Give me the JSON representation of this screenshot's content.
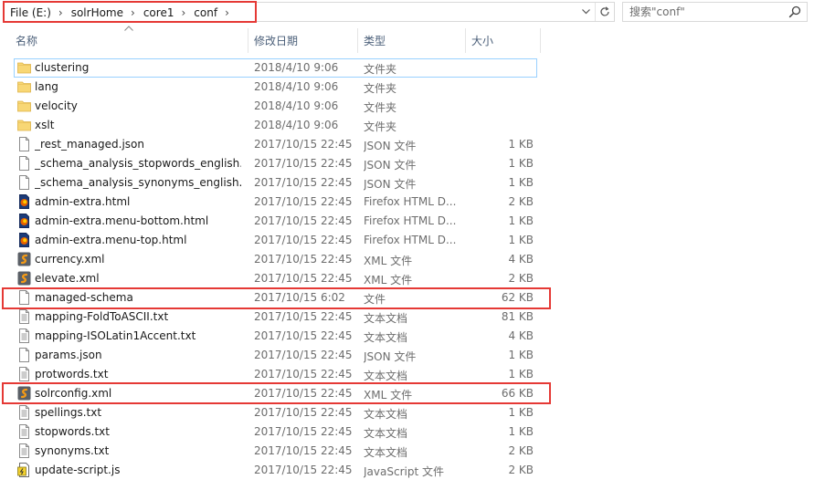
{
  "breadcrumb": [
    "File (E:)",
    "solrHome",
    "core1",
    "conf"
  ],
  "search": {
    "placeholder": "搜索\"conf\""
  },
  "columns": {
    "name": "名称",
    "modified": "修改日期",
    "type": "类型",
    "size": "大小"
  },
  "colors": {
    "highlight": "#e53935",
    "focus": "#99d1ff",
    "folder": "#f8d775",
    "xml": "#f59b16",
    "firefox": "#e66000"
  },
  "files": [
    {
      "name": "clustering",
      "modified": "2018/4/10 9:06",
      "type": "文件夹",
      "size": "",
      "icon": "folder-icon"
    },
    {
      "name": "lang",
      "modified": "2018/4/10 9:06",
      "type": "文件夹",
      "size": "",
      "icon": "folder-icon"
    },
    {
      "name": "velocity",
      "modified": "2018/4/10 9:06",
      "type": "文件夹",
      "size": "",
      "icon": "folder-icon"
    },
    {
      "name": "xslt",
      "modified": "2018/4/10 9:06",
      "type": "文件夹",
      "size": "",
      "icon": "folder-icon"
    },
    {
      "name": "_rest_managed.json",
      "modified": "2017/10/15 22:45",
      "type": "JSON 文件",
      "size": "1 KB",
      "icon": "file-icon"
    },
    {
      "name": "_schema_analysis_stopwords_english....",
      "modified": "2017/10/15 22:45",
      "type": "JSON 文件",
      "size": "1 KB",
      "icon": "file-icon"
    },
    {
      "name": "_schema_analysis_synonyms_english.j...",
      "modified": "2017/10/15 22:45",
      "type": "JSON 文件",
      "size": "1 KB",
      "icon": "file-icon"
    },
    {
      "name": "admin-extra.html",
      "modified": "2017/10/15 22:45",
      "type": "Firefox HTML D...",
      "size": "2 KB",
      "icon": "firefox-html-icon"
    },
    {
      "name": "admin-extra.menu-bottom.html",
      "modified": "2017/10/15 22:45",
      "type": "Firefox HTML D...",
      "size": "1 KB",
      "icon": "firefox-html-icon"
    },
    {
      "name": "admin-extra.menu-top.html",
      "modified": "2017/10/15 22:45",
      "type": "Firefox HTML D...",
      "size": "1 KB",
      "icon": "firefox-html-icon"
    },
    {
      "name": "currency.xml",
      "modified": "2017/10/15 22:45",
      "type": "XML 文件",
      "size": "4 KB",
      "icon": "xml-file-icon"
    },
    {
      "name": "elevate.xml",
      "modified": "2017/10/15 22:45",
      "type": "XML 文件",
      "size": "2 KB",
      "icon": "xml-file-icon"
    },
    {
      "name": "managed-schema",
      "modified": "2017/10/15 6:02",
      "type": "文件",
      "size": "62 KB",
      "icon": "file-icon"
    },
    {
      "name": "mapping-FoldToASCII.txt",
      "modified": "2017/10/15 22:45",
      "type": "文本文档",
      "size": "81 KB",
      "icon": "text-file-icon"
    },
    {
      "name": "mapping-ISOLatin1Accent.txt",
      "modified": "2017/10/15 22:45",
      "type": "文本文档",
      "size": "4 KB",
      "icon": "text-file-icon"
    },
    {
      "name": "params.json",
      "modified": "2017/10/15 22:45",
      "type": "JSON 文件",
      "size": "1 KB",
      "icon": "file-icon"
    },
    {
      "name": "protwords.txt",
      "modified": "2017/10/15 22:45",
      "type": "文本文档",
      "size": "1 KB",
      "icon": "text-file-icon"
    },
    {
      "name": "solrconfig.xml",
      "modified": "2017/10/15 22:45",
      "type": "XML 文件",
      "size": "66 KB",
      "icon": "xml-file-icon"
    },
    {
      "name": "spellings.txt",
      "modified": "2017/10/15 22:45",
      "type": "文本文档",
      "size": "1 KB",
      "icon": "text-file-icon"
    },
    {
      "name": "stopwords.txt",
      "modified": "2017/10/15 22:45",
      "type": "文本文档",
      "size": "1 KB",
      "icon": "text-file-icon"
    },
    {
      "name": "synonyms.txt",
      "modified": "2017/10/15 22:45",
      "type": "文本文档",
      "size": "2 KB",
      "icon": "text-file-icon"
    },
    {
      "name": "update-script.js",
      "modified": "2017/10/15 22:45",
      "type": "JavaScript 文件",
      "size": "2 KB",
      "icon": "javascript-file-icon"
    }
  ]
}
